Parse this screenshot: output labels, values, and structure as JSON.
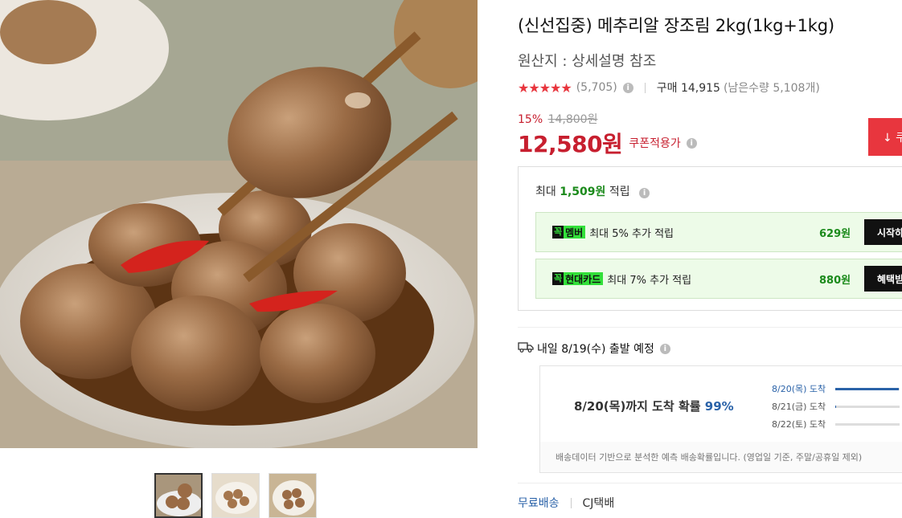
{
  "product": {
    "title": "(신선집중) 메추리알 장조림 2kg(1kg+1kg)",
    "origin": "원산지 : 상세설명 참조",
    "rating_stars": "★★★★★",
    "rating_count": "(5,705)",
    "purchase_label": "구매 14,915",
    "remaining": "(남은수량 5,108개)"
  },
  "price": {
    "discount_rate": "15%",
    "original": "14,800원",
    "sale": "12,580원",
    "coupon_label": "쿠폰적용가",
    "coupon_button": "↓ 쿠"
  },
  "reward": {
    "prefix": "최대 ",
    "amount": "1,509원",
    "suffix": " 적립",
    "benefits": [
      {
        "badge_k": "꼭",
        "badge": "멤버",
        "text": "최대 5% 추가 적립",
        "amount": "629원",
        "button": "시작하"
      },
      {
        "badge_k": "꼭",
        "badge": "현대카드",
        "text": "최대 7% 추가 적립",
        "amount": "880원",
        "button": "혜택받"
      }
    ]
  },
  "shipping": {
    "departure": "내일 8/19(수) 출발 예정",
    "prob_main": "8/20(목)까지 도착 확률 ",
    "prob_pct": "99%",
    "prob_items": [
      {
        "label": "8/20(목) 도착",
        "value": 0.99
      },
      {
        "label": "8/21(금) 도착",
        "value": 0.01
      },
      {
        "label": "8/22(토) 도착",
        "value": 0.0
      }
    ],
    "note": "배송데이터 기반으로 분석한 예측 배송확률입니다. (영업일 기준, 주말/공휴일 제외)",
    "free": "무료배송",
    "carrier": "CJ택배"
  },
  "colors": {
    "accent_red": "#e8363e",
    "price_red": "#c71f2f",
    "green": "#1b8a1b",
    "blue": "#2a62a8"
  },
  "icons": [
    "info-icon",
    "truck-icon",
    "download-icon",
    "star-icon"
  ]
}
